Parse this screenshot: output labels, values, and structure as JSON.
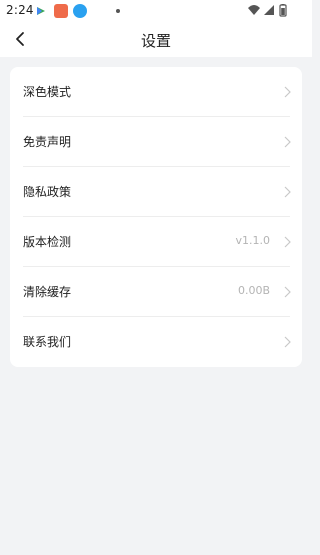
{
  "status_bar": {
    "time": "2:24"
  },
  "header": {
    "title": "设置"
  },
  "settings": {
    "items": [
      {
        "label": "深色模式",
        "value": ""
      },
      {
        "label": "免责声明",
        "value": ""
      },
      {
        "label": "隐私政策",
        "value": ""
      },
      {
        "label": "版本检测",
        "value": "v1.1.0"
      },
      {
        "label": "清除缓存",
        "value": "0.00B"
      },
      {
        "label": "联系我们",
        "value": ""
      }
    ]
  },
  "colors": {
    "background": "#f2f3f5",
    "card": "#ffffff",
    "secondary_text": "#b4b4b4",
    "divider": "#ededed"
  },
  "icons": {
    "back": "chevron-left-icon",
    "row_arrow": "chevron-right-icon",
    "wifi": "wifi-icon",
    "signal": "signal-icon",
    "battery": "battery-icon"
  }
}
